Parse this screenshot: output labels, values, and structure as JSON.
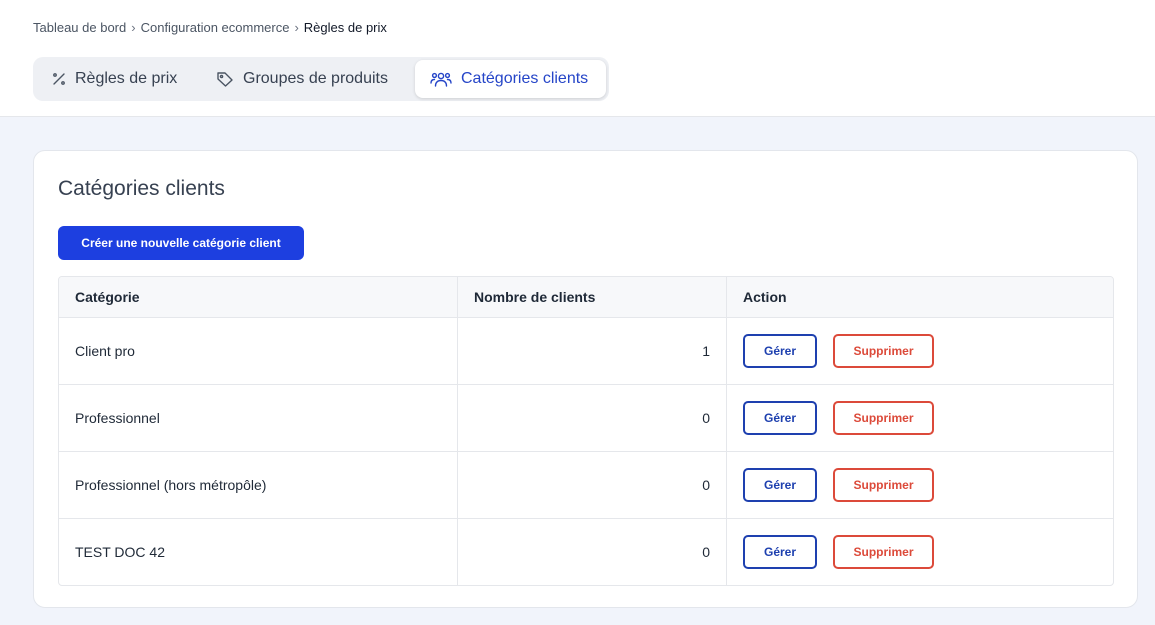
{
  "breadcrumb": {
    "items": [
      "Tableau de bord",
      "Configuration ecommerce",
      "Règles de prix"
    ],
    "separator": "›"
  },
  "tabs": [
    {
      "label": "Règles de prix",
      "icon": "percent-icon",
      "active": false
    },
    {
      "label": "Groupes de produits",
      "icon": "tag-icon",
      "active": false
    },
    {
      "label": "Catégories clients",
      "icon": "users-icon",
      "active": true
    }
  ],
  "card": {
    "title": "Catégories clients",
    "create_button": "Créer une nouvelle catégorie client"
  },
  "table": {
    "columns": [
      "Catégorie",
      "Nombre de clients",
      "Action"
    ],
    "rows": [
      {
        "category": "Client pro",
        "count": "1"
      },
      {
        "category": "Professionnel",
        "count": "0"
      },
      {
        "category": "Professionnel (hors métropôle)",
        "count": "0"
      },
      {
        "category": "TEST DOC 42",
        "count": "0"
      }
    ],
    "actions": {
      "manage": "Gérer",
      "delete": "Supprimer"
    }
  },
  "colors": {
    "accent": "#1d3fe0",
    "active_tab_text": "#2545c8",
    "manage_border": "#1e40af",
    "delete_border": "#dc4a3a",
    "page_background": "#f1f4fb"
  }
}
